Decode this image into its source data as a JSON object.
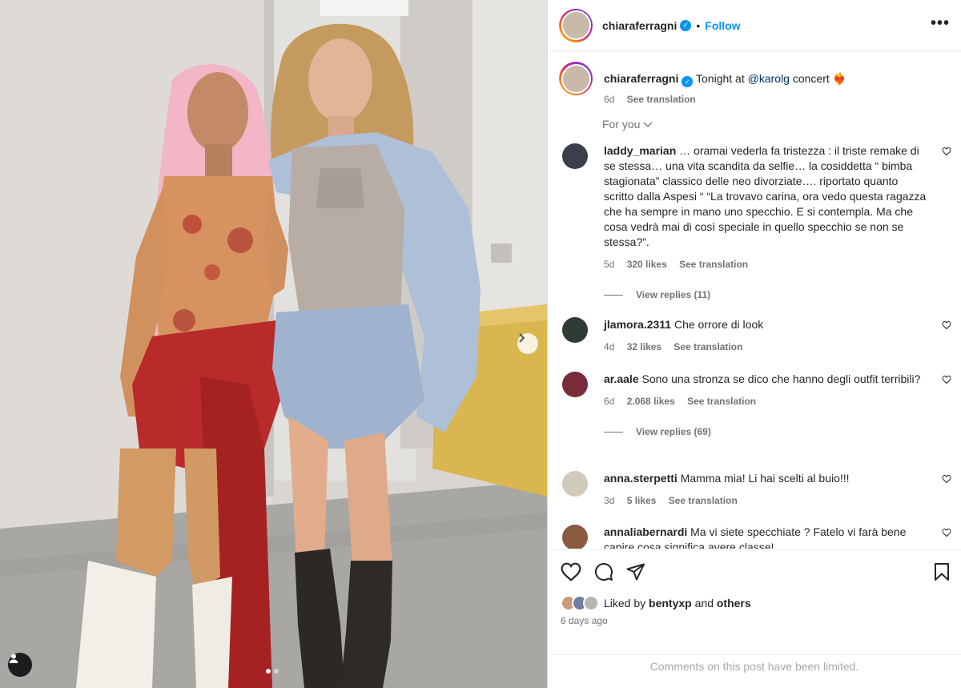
{
  "post": {
    "image_alt": "Two women posing backstage",
    "carousel": {
      "current": 1,
      "total": 2
    }
  },
  "header": {
    "username": "chiaraferragni",
    "separator": "•",
    "follow_label": "Follow",
    "more_label": "•••"
  },
  "caption": {
    "username": "chiaraferragni",
    "text_before": "Tonight at ",
    "mention": "@karolg",
    "text_after": " concert ❤️‍🔥",
    "age": "6d",
    "see_translation": "See translation"
  },
  "sort": {
    "label": "For you"
  },
  "comments": [
    {
      "username": "laddy_marian",
      "text": "… oramai vederla fa tristezza : il triste remake di se stessa… una vita scandita da selfie… la cosiddetta “ bimba stagionata” classico delle neo divorziate…. riportato quanto scritto dalla Aspesi “ “La trovavo carina, ora vedo questa ragazza che ha sempre in mano uno specchio. E si contempla. Ma che cosa vedrà mai di così speciale in quello specchio se non se stessa?”.",
      "age": "5d",
      "likes": "320 likes",
      "translate": "See translation",
      "replies": "View replies (11)",
      "avatar_color": "#3a3f4a"
    },
    {
      "username": "jlamora.2311",
      "text": "Che orrore di look",
      "age": "4d",
      "likes": "32 likes",
      "translate": "See translation",
      "avatar_color": "#2f3b33"
    },
    {
      "username": "ar.aale",
      "text": "Sono una stronza se dico che hanno degli outfit terribili?",
      "age": "6d",
      "likes": "2.068 likes",
      "translate": "See translation",
      "replies": "View replies (69)",
      "avatar_color": "#7a2b3a"
    },
    {
      "username": "anna.sterpetti",
      "text": "Mamma mia! Li hai scelti al buio!!!",
      "age": "3d",
      "likes": "5 likes",
      "translate": "See translation",
      "avatar_color": "#cfcbb8"
    },
    {
      "username": "annaliabernardi",
      "text": "Ma vi siete specchiate ? Fatelo vi farà bene capire cosa significa avere classe!",
      "avatar_color": "#8a5a3e"
    }
  ],
  "footer": {
    "liked_by_prefix": "Liked by ",
    "liked_by_user": "bentyxp",
    "liked_by_and": " and ",
    "liked_by_others": "others",
    "time": "6 days ago",
    "limited_notice": "Comments on this post have been limited."
  },
  "colors": {
    "link_blue": "#0095f6",
    "mention": "#00376b",
    "secondary_text": "#737373",
    "divider": "#efefef"
  }
}
